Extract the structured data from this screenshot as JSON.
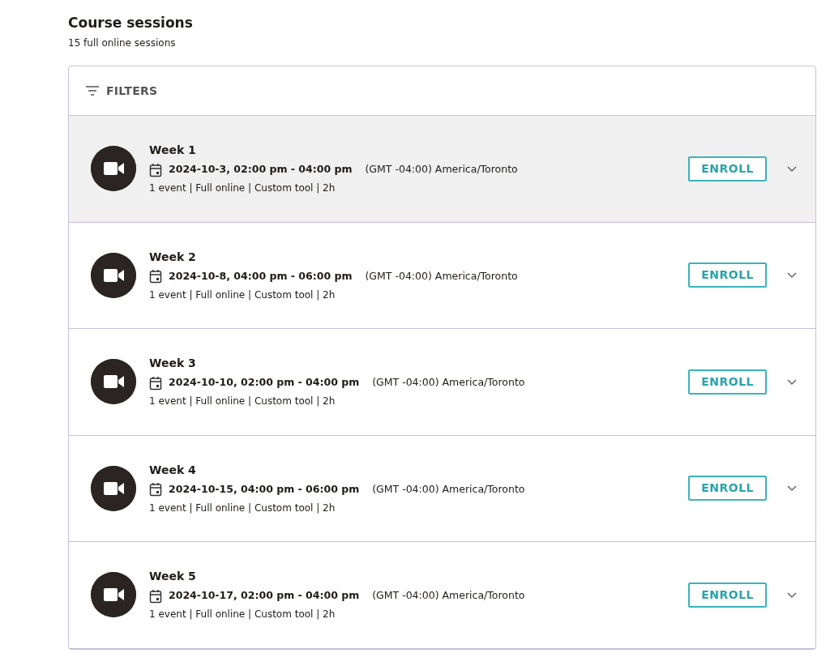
{
  "heading": {
    "title": "Course sessions",
    "subtitle": "15 full online sessions"
  },
  "filters": {
    "label": "FILTERS"
  },
  "sessions": [
    {
      "title": "Week 1",
      "datetime": "2024-10-3, 02:00 pm - 04:00 pm",
      "timezone": "(GMT -04:00) America/Toronto",
      "details": "1 event | Full online | Custom tool | 2h",
      "button": "ENROLL",
      "highlighted": true
    },
    {
      "title": "Week 2",
      "datetime": "2024-10-8, 04:00 pm - 06:00 pm",
      "timezone": "(GMT -04:00) America/Toronto",
      "details": "1 event | Full online | Custom tool | 2h",
      "button": "ENROLL",
      "highlighted": false
    },
    {
      "title": "Week 3",
      "datetime": "2024-10-10, 02:00 pm - 04:00 pm",
      "timezone": "(GMT -04:00) America/Toronto",
      "details": "1 event | Full online | Custom tool | 2h",
      "button": "ENROLL",
      "highlighted": false
    },
    {
      "title": "Week 4",
      "datetime": "2024-10-15, 04:00 pm - 06:00 pm",
      "timezone": "(GMT -04:00) America/Toronto",
      "details": "1 event | Full online | Custom tool | 2h",
      "button": "ENROLL",
      "highlighted": false
    },
    {
      "title": "Week 5",
      "datetime": "2024-10-17, 02:00 pm - 04:00 pm",
      "timezone": "(GMT -04:00) America/Toronto",
      "details": "1 event | Full online | Custom tool | 2h",
      "button": "ENROLL",
      "highlighted": false
    }
  ]
}
